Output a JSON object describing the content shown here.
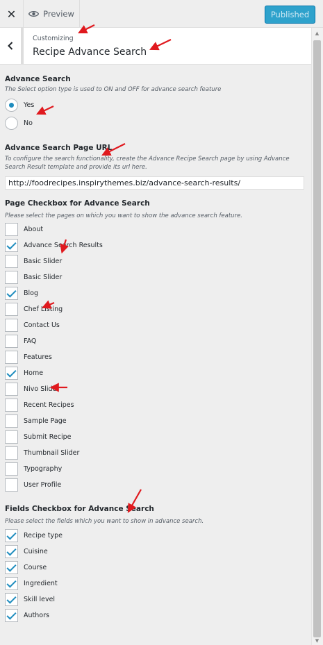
{
  "topbar": {
    "close_symbol": "✕",
    "preview_label": "Preview",
    "publish_label": "Published"
  },
  "section": {
    "crumb": "Customizing",
    "title": "Recipe Advance Search"
  },
  "advance_search": {
    "title": "Advance Search",
    "description": "The Select option type is used to ON and OFF for advance search feature",
    "options": [
      {
        "label": "Yes",
        "selected": true
      },
      {
        "label": "No",
        "selected": false
      }
    ]
  },
  "page_url": {
    "title": "Advance Search Page URL",
    "description": "To configure the search functionality, create the Advance Recipe Search page by using Advance Search Result template and provide its url here.",
    "value": "http://foodrecipes.inspirythemes.biz/advance-search-results/"
  },
  "page_checkbox": {
    "title": "Page Checkbox for Advance Search",
    "description": "Please select the pages on which you want to show the advance search feature.",
    "items": [
      {
        "label": "About",
        "checked": false
      },
      {
        "label": "Advance Search Results",
        "checked": true
      },
      {
        "label": "Basic Slider",
        "checked": false
      },
      {
        "label": "Basic Slider",
        "checked": false
      },
      {
        "label": "Blog",
        "checked": true
      },
      {
        "label": "Chef Listing",
        "checked": false
      },
      {
        "label": "Contact Us",
        "checked": false
      },
      {
        "label": "FAQ",
        "checked": false
      },
      {
        "label": "Features",
        "checked": false
      },
      {
        "label": "Home",
        "checked": true
      },
      {
        "label": "Nivo Slider",
        "checked": false
      },
      {
        "label": "Recent Recipes",
        "checked": false
      },
      {
        "label": "Sample Page",
        "checked": false
      },
      {
        "label": "Submit Recipe",
        "checked": false
      },
      {
        "label": "Thumbnail Slider",
        "checked": false
      },
      {
        "label": "Typography",
        "checked": false
      },
      {
        "label": "User Profile",
        "checked": false
      }
    ]
  },
  "fields_checkbox": {
    "title": "Fields Checkbox for Advance Search",
    "description": "Please select the fields which you want to show in advance search.",
    "items": [
      {
        "label": "Recipe type",
        "checked": true
      },
      {
        "label": "Cuisine",
        "checked": true
      },
      {
        "label": "Course",
        "checked": true
      },
      {
        "label": "Ingredient",
        "checked": true
      },
      {
        "label": "Skill level",
        "checked": true
      },
      {
        "label": "Authors",
        "checked": true
      }
    ]
  },
  "colors": {
    "accent": "#1e8cbe",
    "publish": "#2ea2cc",
    "annotation": "#e0191e"
  },
  "icons": {
    "close": "close-icon",
    "preview": "eye-icon",
    "back": "chevron-left-icon",
    "annotation": "red-arrow-icon"
  }
}
